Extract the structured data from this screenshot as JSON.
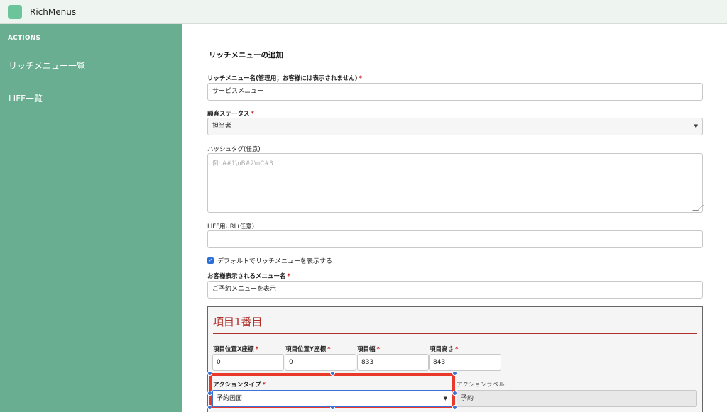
{
  "app": {
    "title": "RichMenus"
  },
  "sidebar": {
    "heading": "ACTIONS",
    "items": [
      {
        "label": "リッチメニュー一覧"
      },
      {
        "label": "LIFF一覧"
      }
    ]
  },
  "form": {
    "title": "リッチメニューの追加",
    "required_mark": "*",
    "name": {
      "label": "リッチメニュー名(管理用；お客様には表示されません)",
      "value": "サービスメニュー"
    },
    "customer_status": {
      "label": "顧客ステータス",
      "value": "担当者"
    },
    "hashtag": {
      "label": "ハッシュタグ(任意)",
      "placeholder": "例: A#1\\nB#2\\nC#3"
    },
    "liff_url": {
      "label": "LIFF用URL(任意)",
      "value": ""
    },
    "default_checkbox": {
      "label": "デフォルトでリッチメニューを表示する",
      "checked": true
    },
    "display_name": {
      "label": "お客様表示されるメニュー名",
      "value": "ご予約メニューを表示"
    },
    "item": {
      "title": "項目1番目",
      "x": {
        "label": "項目位置X座標",
        "value": "0"
      },
      "y": {
        "label": "項目位置Y座標",
        "value": "0"
      },
      "width": {
        "label": "項目幅",
        "value": "833"
      },
      "height": {
        "label": "項目高さ",
        "value": "843"
      },
      "action_type": {
        "label": "アクションタイプ",
        "value": "予約画面"
      },
      "action_label": {
        "label": "アクションラベル",
        "value": "予約"
      }
    }
  },
  "colors": {
    "sidebar": "#6aae92",
    "accent_red": "#b0302a",
    "highlight": "#e8392b",
    "handle": "#3a72d8"
  }
}
